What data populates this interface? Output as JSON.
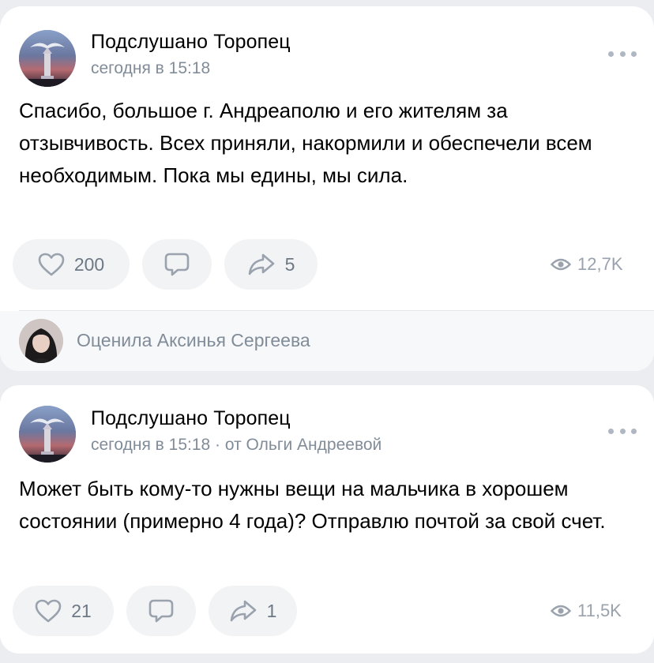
{
  "posts": [
    {
      "author": "Подслушано Торопец",
      "time": "сегодня в 15:18",
      "text": "Спасибо, большое г. Андреаполю и его жителям за отзывчивость. Всех приняли, накормили и обеспечели всем необходимым. Пока мы едины, мы сила.",
      "likes": "200",
      "comments": "",
      "shares": "5",
      "views": "12,7K",
      "liked_by": "Оценила Аксинья Сергеева"
    },
    {
      "author": "Подслушано Торопец",
      "time": "сегодня в 15:18 · от Ольги Андреевой",
      "text": "Может быть кому-то нужны вещи на мальчика в хорошем состоянии (примерно 4 года)? Отправлю почтой за свой счет.",
      "likes": "21",
      "comments": "",
      "shares": "1",
      "views": "11,5K"
    }
  ],
  "icons": {
    "like": "heart-outline-icon",
    "comment": "comment-bubble-icon",
    "share": "share-arrow-icon",
    "views": "eye-icon",
    "more": "more-dots-icon"
  },
  "colors": {
    "background": "#ebedf0",
    "card": "#ffffff",
    "secondary_text": "#818c99",
    "icon": "#99a2ad",
    "pill": "#f2f3f5"
  }
}
